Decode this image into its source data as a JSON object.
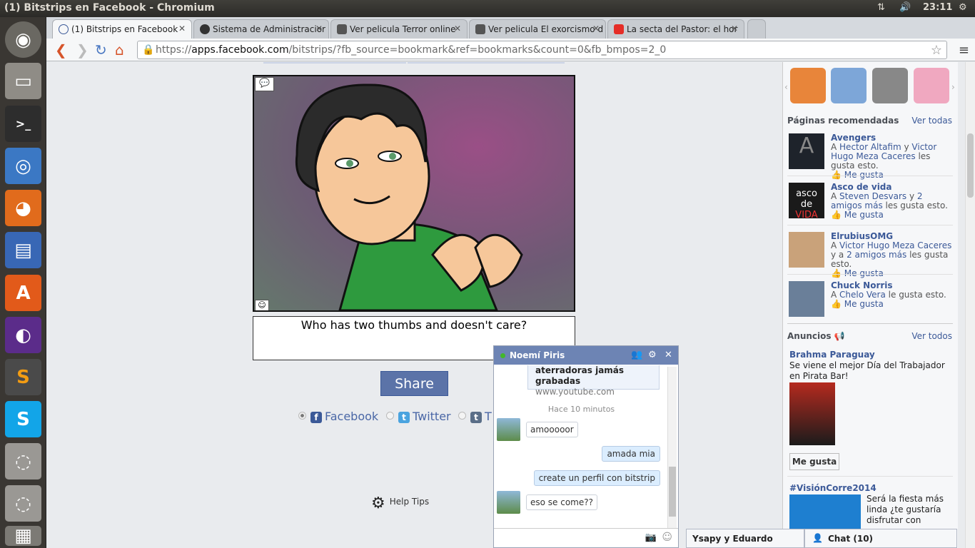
{
  "window": {
    "title": "(1) Bitstrips en Facebook - Chromium",
    "clock": "23:11"
  },
  "launcher": [
    "ubuntu-dash",
    "files",
    "terminal",
    "chromium",
    "firefox",
    "libreoffice-writer",
    "software-center",
    "eclipse",
    "sublime-text",
    "skype",
    "drive-1",
    "drive-2",
    "trash"
  ],
  "tabs": [
    {
      "label": "(1) Bitstrips en Facebook",
      "active": true
    },
    {
      "label": "Sistema de Administracior",
      "active": false
    },
    {
      "label": "Ver pelicula Terror online",
      "active": false
    },
    {
      "label": "Ver pelicula El exorcismo d",
      "active": false
    },
    {
      "label": "La secta del Pastor: el hor",
      "active": false
    }
  ],
  "address": {
    "scheme": "https://",
    "host": "apps.facebook.com",
    "path": "/bitstrips/?fb_source=bookmark&ref=bookmarks&count=0&fb_bmpos=2_0"
  },
  "comic": {
    "caption": "Who has two thumbs and doesn't care?"
  },
  "share": {
    "label": "Share",
    "options": [
      "Facebook",
      "Twitter",
      "T"
    ]
  },
  "help": {
    "label": "Help Tips"
  },
  "sidebar": {
    "pages_header": "Páginas recomendadas",
    "see_all": "Ver todas",
    "like_label": "Me gusta",
    "recommendations": [
      {
        "name": "Avengers",
        "pre": "A ",
        "friend": "Hector Altafim",
        "mid": " y ",
        "friend2": "Victor Hugo Meza Caceres",
        "post": " les gusta esto."
      },
      {
        "name": "Asco de vida",
        "pre": "A ",
        "friend": "Steven Desvars",
        "mid": " y ",
        "friend2": "2 amigos más",
        "post": " les gusta esto."
      },
      {
        "name": "ElrubiusOMG",
        "pre": "A ",
        "friend": "Victor Hugo Meza Caceres",
        "mid": " y a ",
        "friend2": "2 amigos más",
        "post": " les gusta esto."
      },
      {
        "name": "Chuck Norris",
        "pre": "A ",
        "friend": "Chelo Vera",
        "mid": "",
        "friend2": "",
        "post": " le gusta esto."
      }
    ],
    "ads_header": "Anuncios",
    "ads_see_all": "Ver todos",
    "ad1": {
      "title": "Brahma Paraguay",
      "body": "Se viene el mejor Día del Trabajador en Pirata Bar!",
      "button": "Me gusta"
    },
    "ad2": {
      "title": "#VisiónCorre2014",
      "body": "Será la fiesta más linda ¿te gustaría disfrutar con"
    }
  },
  "chat": {
    "contact": "Noemí Piris",
    "link_title": "aterradoras jamás grabadas",
    "link_url": "www.youtube.com",
    "time": "Hace 10 minutos",
    "messages": [
      {
        "dir": "in",
        "text": "amooooor"
      },
      {
        "dir": "out",
        "text": "amada mia"
      },
      {
        "dir": "out",
        "text": "create un perfil con bitstrip"
      },
      {
        "dir": "in",
        "text": "eso se come??"
      }
    ],
    "dock_other": "Ysapy y Eduardo",
    "dock_chat": "Chat (10)"
  }
}
